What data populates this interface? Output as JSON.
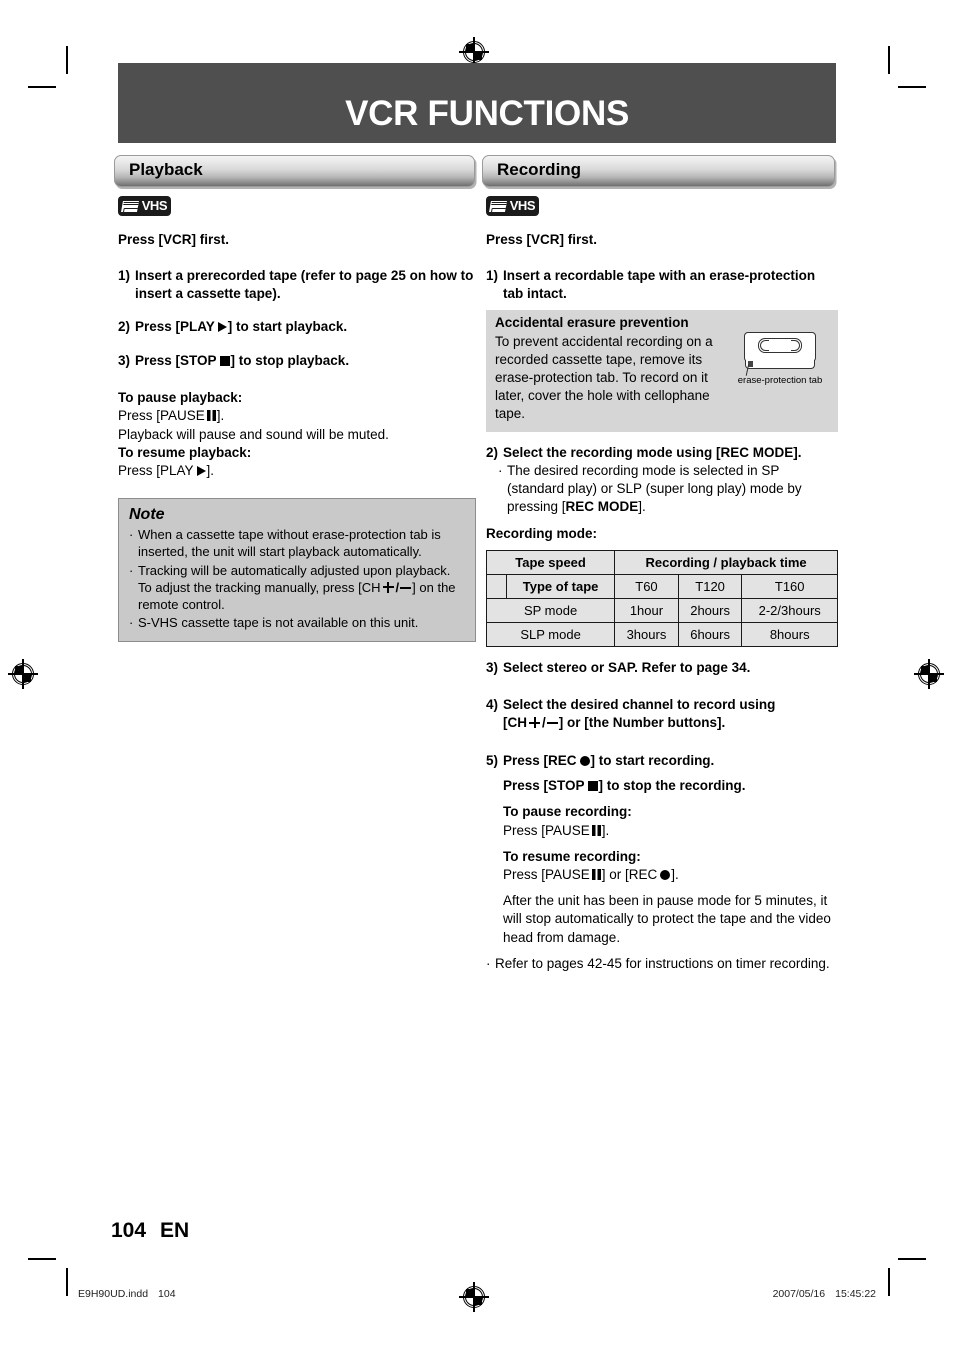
{
  "page": {
    "title": "VCR FUNCTIONS",
    "page_number": "104",
    "page_lang": "EN",
    "footer_left_file": "E9H90UD.indd",
    "footer_left_page": "104",
    "footer_right_date": "2007/05/16",
    "footer_right_time": "15:45:22",
    "banner_color": "#4f4f4f",
    "note_box_color": "#c9c9c9",
    "shade_box_color": "#d6d6d6",
    "table_bg_color": "#e3e3e3"
  },
  "left_column": {
    "section_title": "Playback",
    "badge_label": "VHS",
    "press_first": "Press [VCR] first.",
    "steps": [
      {
        "num": "1)",
        "text": "Insert a prerecorded tape (refer to page 25 on how to insert a cassette tape)."
      },
      {
        "num": "2)",
        "text_pre": "Press [PLAY",
        "text_post": "] to start playback.",
        "glyph": "play-icon"
      },
      {
        "num": "3)",
        "text_pre": "Press [STOP",
        "text_post": "] to stop playback.",
        "glyph": "stop-icon"
      }
    ],
    "pause_heading": "To pause playback:",
    "pause_press_pre": "Press [PAUSE",
    "pause_press_post": "].",
    "pause_note": "Playback will pause and sound will be muted.",
    "resume_heading": "To resume playback:",
    "resume_press_pre": "Press [PLAY",
    "resume_press_post": "].",
    "note": {
      "title": "Note",
      "items": [
        "When a cassette tape without erase-protection tab is inserted, the unit will start playback automatically.",
        "Tracking will be automatically adjusted upon playback. To adjust the tracking manually, press [CH",
        "S-VHS cassette tape is not available on this unit."
      ],
      "item2_tail": "] on the remote control."
    }
  },
  "right_column": {
    "section_title": "Recording",
    "badge_label": "VHS",
    "press_first": "Press [VCR] first.",
    "step1": {
      "num": "1)",
      "text": "Insert a recordable tape with an erase-protection tab intact."
    },
    "erase_box": {
      "title": "Accidental erasure prevention",
      "text": "To prevent accidental recording on a recorded cassette tape, remove its erase-protection tab. To record on it later, cover the hole with cellophane tape.",
      "figure_caption": "erase-protection tab"
    },
    "step2": {
      "num": "2)",
      "text": "Select the recording mode using [REC MODE].",
      "bullet_pre": "The desired recording mode is selected in SP (standard play) or SLP (super long play) mode by pressing [",
      "bullet_bold": "REC MODE",
      "bullet_post": "]."
    },
    "recording_mode_label": "Recording mode:",
    "table": {
      "row1": {
        "c1": "Tape speed",
        "c2": "Recording / playback time"
      },
      "row2": {
        "c1": "",
        "c2": "Type of tape",
        "c3": "T60",
        "c4": "T120",
        "c5": "T160"
      },
      "row3": {
        "c1": "SP mode",
        "c2": "1hour",
        "c3": "2hours",
        "c4": "2-2/3hours"
      },
      "row4": {
        "c1": "SLP mode",
        "c2": "3hours",
        "c3": "6hours",
        "c4": "8hours"
      }
    },
    "step3": {
      "num": "3)",
      "text": "Select stereo or SAP. Refer to page 34."
    },
    "step4": {
      "num": "4)",
      "line1": "Select the desired channel to record using",
      "line2_pre": "[CH",
      "line2_mid": "/",
      "line2_post": "] or [the Number buttons]."
    },
    "step5": {
      "num": "5)",
      "line1_pre": "Press [REC",
      "line1_post": "] to start recording.",
      "line2_pre": "Press [STOP",
      "line2_post": "] to stop the recording.",
      "pause_heading": "To pause recording:",
      "pause_press_pre": "Press [PAUSE",
      "pause_press_post": "].",
      "resume_heading": "To resume recording:",
      "resume_press_pre": "Press [PAUSE",
      "resume_press_mid": "] or [REC",
      "resume_press_post": "].",
      "timeout_note": "After the unit has been in pause mode for 5 minutes, it will stop automatically to protect the tape and the video head from damage."
    },
    "final_bullet": "Refer to pages 42-45 for instructions on timer recording."
  }
}
